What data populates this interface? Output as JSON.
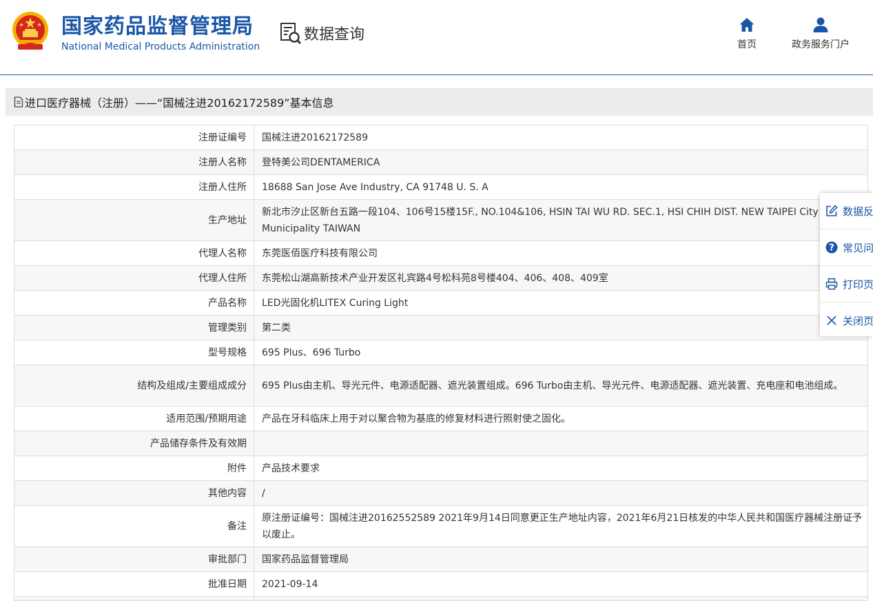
{
  "header": {
    "brand_cn": "国家药品监督管理局",
    "brand_en": "National Medical Products Administration",
    "section": "数据查询",
    "nav": [
      {
        "label": "首页",
        "icon": "home-icon"
      },
      {
        "label": "政务服务门户",
        "icon": "user-icon"
      }
    ]
  },
  "page": {
    "title": "进口医疗器械（注册）——“国械注进20162172589”基本信息"
  },
  "rows": [
    {
      "label": "注册证编号",
      "value": "国械注进20162172589"
    },
    {
      "label": "注册人名称",
      "value": "登特美公司DENTAMERICA"
    },
    {
      "label": "注册人住所",
      "value": "18688 San Jose Ave Industry, CA 91748 U. S. A"
    },
    {
      "label": "生产地址",
      "value": "新北市汐止区新台五路一段104、106号15楼15F., NO.104&106, HSIN TAI WU RD. SEC.1, HSI CHIH DIST. NEW TAIPEI City - Special Municipality TAIWAN"
    },
    {
      "label": "代理人名称",
      "value": "东莞医佰医疗科技有限公司"
    },
    {
      "label": "代理人住所",
      "value": "东莞松山湖高新技术产业开发区礼宾路4号松科苑8号楼404、406、408、409室"
    },
    {
      "label": "产品名称",
      "value": "LED光固化机LITEX Curing Light"
    },
    {
      "label": "管理类别",
      "value": "第二类"
    },
    {
      "label": "型号规格",
      "value": "695 Plus、696 Turbo"
    },
    {
      "label": "结构及组成/主要组成成分",
      "value": "695 Plus由主机、导光元件、电源适配器、遮光装置组成。696 Turbo由主机、导光元件、电源适配器、遮光装置、充电座和电池组成。"
    },
    {
      "label": "适用范围/预期用途",
      "value": "产品在牙科临床上用于对以聚合物为基底的修复材料进行照射使之固化。"
    },
    {
      "label": "产品储存条件及有效期",
      "value": ""
    },
    {
      "label": "附件",
      "value": "产品技术要求"
    },
    {
      "label": "其他内容",
      "value": "/"
    },
    {
      "label": "备注",
      "value": "原注册证编号：国械注进20162552589 2021年9月14日同意更正生产地址内容，2021年6月21日核发的中华人民共和国医疗器械注册证予以废止。"
    },
    {
      "label": "审批部门",
      "value": "国家药品监督管理局"
    },
    {
      "label": "批准日期",
      "value": "2021-09-14"
    }
  ],
  "side_panel": [
    {
      "label": "数据反馈",
      "icon": "edit-icon"
    },
    {
      "label": "常见问题",
      "icon": "question-icon"
    },
    {
      "label": "打印页面",
      "icon": "print-icon"
    },
    {
      "label": "关闭页面",
      "icon": "close-icon"
    }
  ],
  "colors": {
    "brand": "#1a56a8",
    "row_alt": "#f7f7f7",
    "border": "#dcdcdc",
    "title_bar": "#ececec"
  }
}
